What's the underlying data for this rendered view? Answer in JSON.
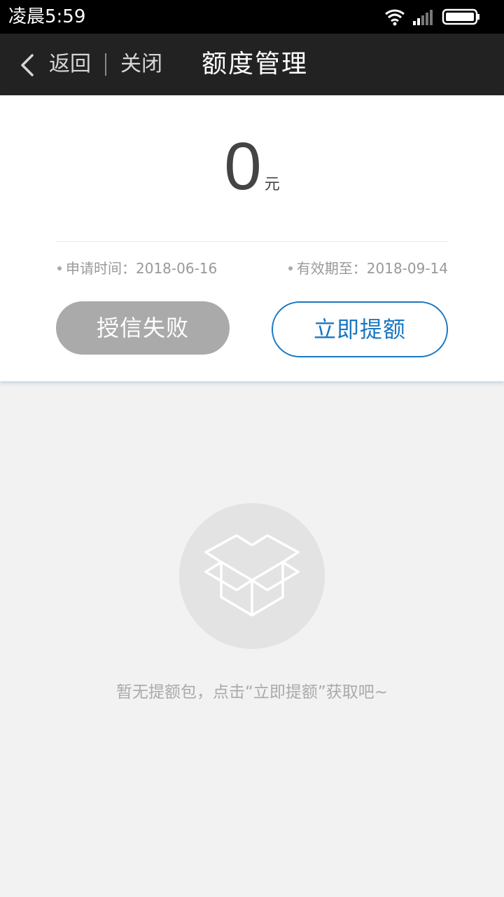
{
  "status_bar": {
    "time": "凌晨5:59",
    "icons": [
      "wifi-icon",
      "signal-icon",
      "battery-icon"
    ]
  },
  "nav": {
    "back_label": "返回",
    "close_label": "关闭",
    "title": "额度管理"
  },
  "credit": {
    "amount": "0",
    "unit": "元",
    "apply_time": "申请时间：2018-06-16",
    "valid_until": "有效期至：2018-09-14"
  },
  "actions": {
    "status_button": "授信失败",
    "raise_button": "立即提额"
  },
  "empty_state": {
    "icon": "box-icon",
    "message": "暂无提额包，点击“立即提额”获取吧~"
  },
  "colors": {
    "nav_bg": "#222222",
    "accent": "#1a78c2",
    "disabled": "#aaaaaa",
    "page_bg": "#f2f2f2"
  }
}
